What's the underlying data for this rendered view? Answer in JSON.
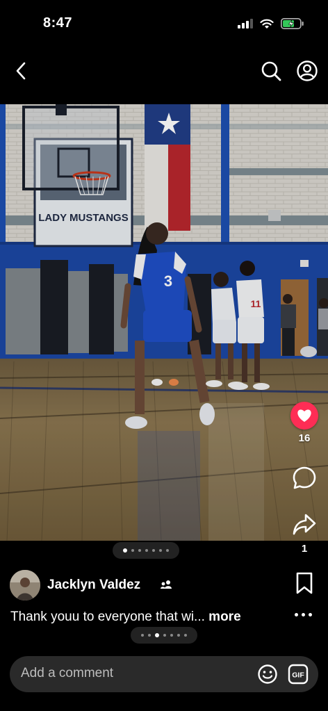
{
  "status_bar": {
    "time": "8:47",
    "icons": [
      "cellular-signal-icon",
      "wifi-icon",
      "battery-charging-icon"
    ]
  },
  "nav": {
    "icons": [
      "back-arrow-icon",
      "search-icon",
      "profile-icon"
    ]
  },
  "photo": {
    "banner_text": "LADY MUSTANGS",
    "jersey_number": "3"
  },
  "actions": {
    "likes": "16",
    "shares": "1",
    "like_color": "#fe2d55"
  },
  "carousel": {
    "photo_count": 7,
    "photo_active": 1,
    "caption_count": 7,
    "caption_active": 3
  },
  "post": {
    "author": "Jacklyn Valdez",
    "caption": "Thank youu to everyone that wi...",
    "more_label": "more"
  },
  "comment_bar": {
    "placeholder": "Add a comment"
  }
}
